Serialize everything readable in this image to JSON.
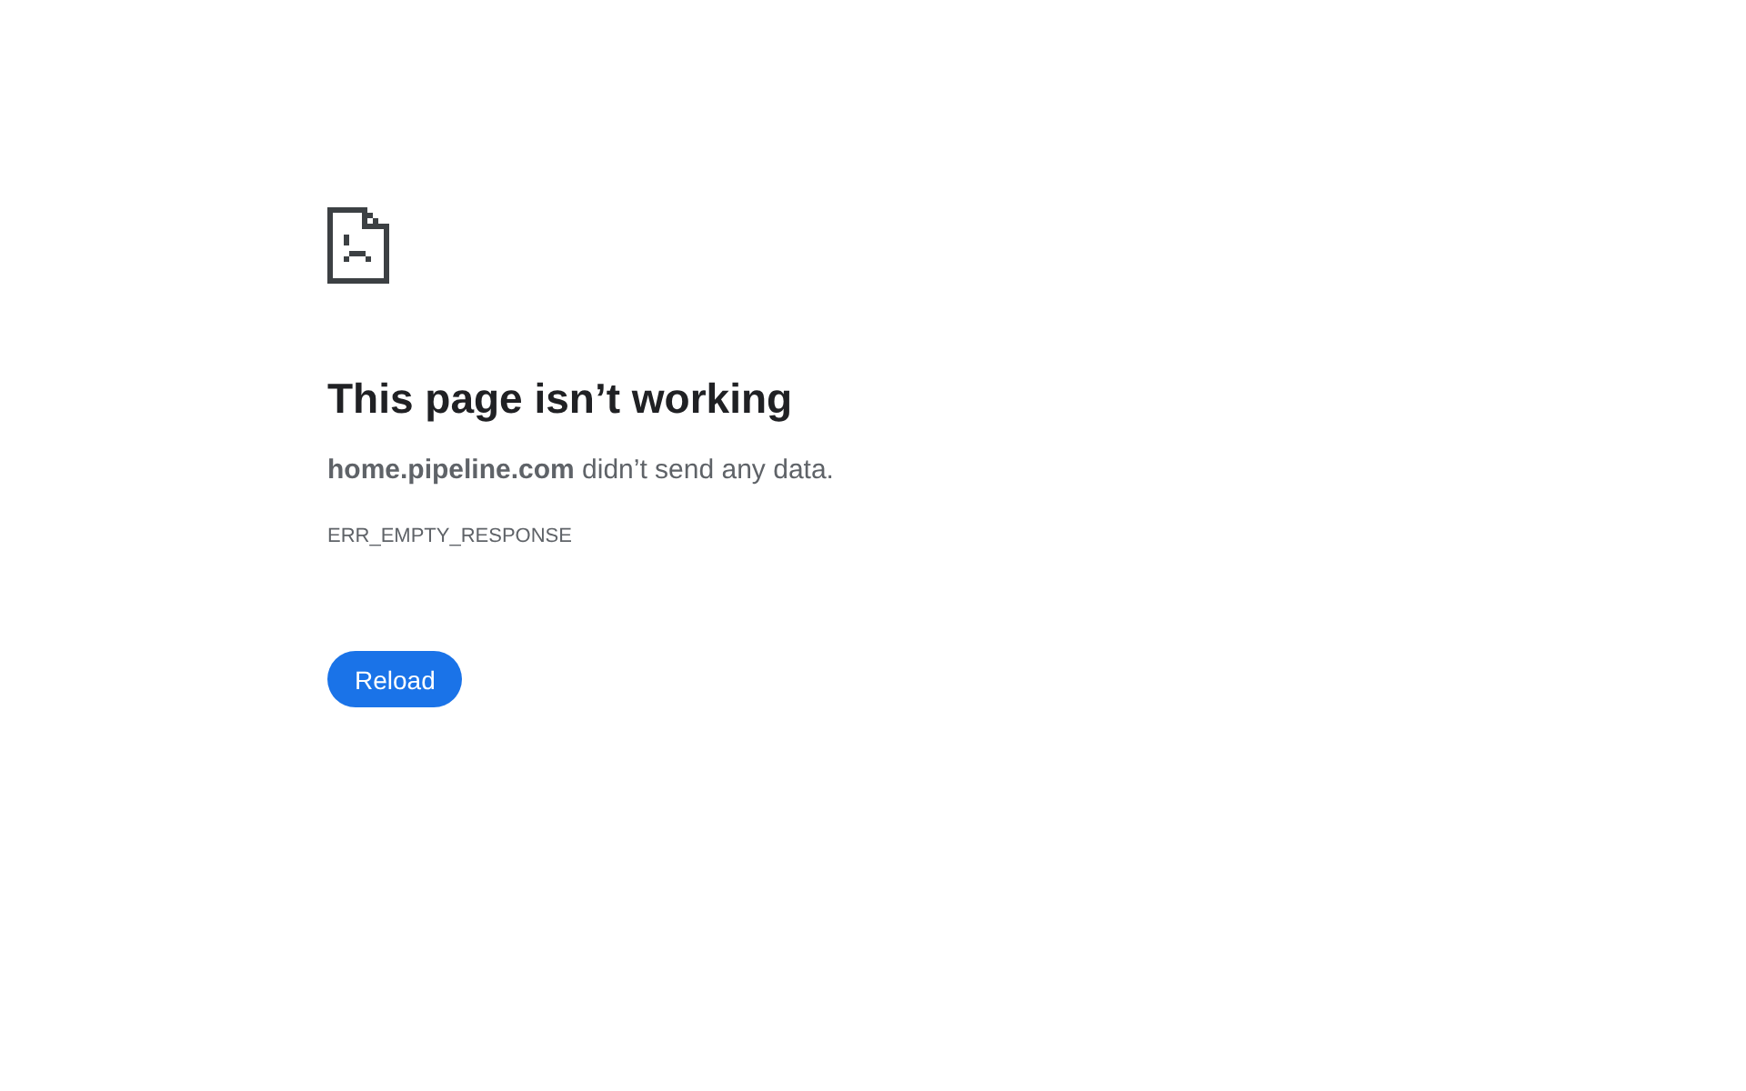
{
  "error_page": {
    "heading": "This page isn’t working",
    "message": "**home.pipeline.com** didn’t send any data.",
    "error_code": "ERR_EMPTY_RESPONSE",
    "buttons": [
      {
        "label": "Reload",
        "kind": "primary"
      }
    ]
  }
}
